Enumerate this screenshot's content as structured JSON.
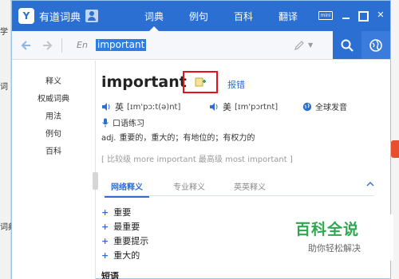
{
  "background": {
    "left_fragments": [
      "学",
      "词",
      "词典"
    ],
    "accent": "#e84f2f"
  },
  "window": {
    "app_title": "有道词典",
    "logo_glyph": "Y",
    "brand_color": "#2c6fd3",
    "tabs": [
      {
        "label": "词典",
        "active": true
      },
      {
        "label": "例句",
        "active": false
      },
      {
        "label": "百科",
        "active": false
      },
      {
        "label": "翻译",
        "active": false
      }
    ],
    "mini_label": "mini",
    "close_glyph": "✕"
  },
  "searchbar": {
    "back_icon": "arrow-left-icon",
    "forward_icon": "arrow-right-icon",
    "lang": "En",
    "query": "important",
    "pen_icon": "pen-icon",
    "search_icon": "search-icon",
    "globe_icon": "globe-icon"
  },
  "sidebar": {
    "items": [
      "释义",
      "权威词典",
      "用法",
      "例句",
      "百科"
    ]
  },
  "entry": {
    "headword": "important",
    "add_icon": "add-to-wordbook-icon",
    "report_label": "报错",
    "uk": {
      "label": "英",
      "ipa": "[ɪm'pɔːt(ə)nt]"
    },
    "us": {
      "label": "美",
      "ipa": "[ɪm'pɔrtnt]"
    },
    "global_pron": "全球发音",
    "oral_practice": "口语练习",
    "pos": "adj.",
    "meaning": "重要的，重大的；有地位的；有权力的",
    "forms": "[ 比较级 more important 最高级 most important ]",
    "subtabs": [
      {
        "label": "网络释义",
        "active": true
      },
      {
        "label": "专业释义",
        "active": false
      },
      {
        "label": "英英释义",
        "active": false
      }
    ],
    "definitions": [
      "重要",
      "最重要",
      "重要提示",
      "重大的"
    ],
    "phrases_heading": "短语"
  },
  "watermark": {
    "big": "百科全说",
    "small": "助你轻松解决",
    "color": "#2ca84e"
  }
}
